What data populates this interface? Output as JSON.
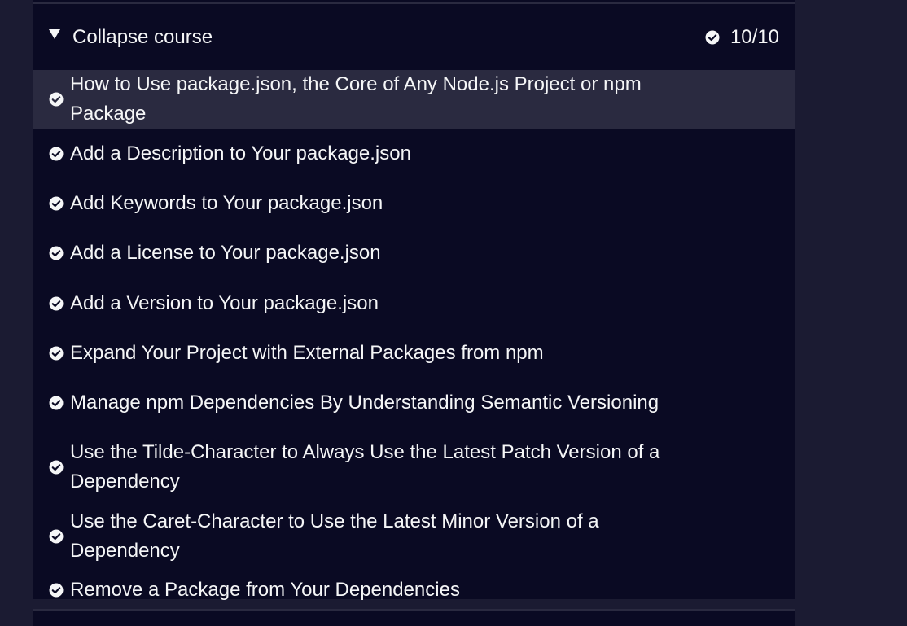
{
  "course": {
    "collapse_label": "Collapse course",
    "progress": "10/10",
    "items": [
      {
        "label": "How to Use package.json, the Core of Any Node.js Project or npm Package",
        "completed": true
      },
      {
        "label": "Add a Description to Your package.json",
        "completed": true
      },
      {
        "label": "Add Keywords to Your package.json",
        "completed": true
      },
      {
        "label": "Add a License to Your package.json",
        "completed": true
      },
      {
        "label": "Add a Version to Your package.json",
        "completed": true
      },
      {
        "label": "Expand Your Project with External Packages from npm",
        "completed": true
      },
      {
        "label": "Manage npm Dependencies By Understanding Semantic Versioning",
        "completed": true
      },
      {
        "label": "Use the Tilde-Character to Always Use the Latest Patch Version of a Dependency",
        "completed": true
      },
      {
        "label": "Use the Caret-Character to Use the Latest Minor Version of a Dependency",
        "completed": true
      },
      {
        "label": "Remove a Package from Your Dependencies",
        "completed": true
      }
    ]
  },
  "icons": {
    "expanded": "caret-down-icon",
    "completed": "check-circle-icon"
  },
  "colors": {
    "page_bg": "#1b1b32",
    "panel_bg": "#0a0a23",
    "highlight_bg": "#2a2a40",
    "text": "#f5f6f7"
  }
}
